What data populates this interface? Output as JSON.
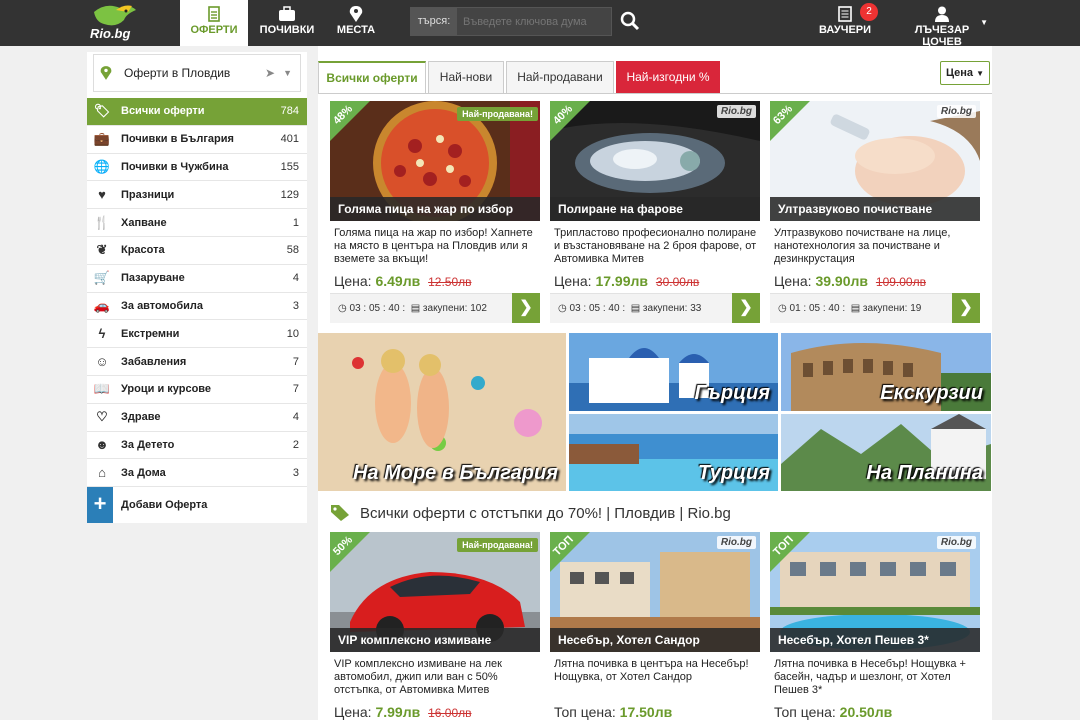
{
  "header": {
    "logo_text": "Rio.bg",
    "nav": [
      {
        "label": "ОФЕРТИ",
        "icon": "document-icon"
      },
      {
        "label": "ПОЧИВКИ",
        "icon": "suitcase-icon"
      },
      {
        "label": "МЕСТА",
        "icon": "map-marker-icon"
      }
    ],
    "search_label": "търся:",
    "search_placeholder": "Въведете ключова дума",
    "vouchers_label": "ВАУЧЕРИ",
    "vouchers_badge": "2",
    "user_name": "ЛЪЧЕЗАР ЦОЧЕВ"
  },
  "sidebar": {
    "city": "Оферти в Пловдив",
    "items": [
      {
        "label": "Всички оферти",
        "count": "784",
        "icon": "tag-icon"
      },
      {
        "label": "Почивки в България",
        "count": "401",
        "icon": "suitcase-icon"
      },
      {
        "label": "Почивки в Чужбина",
        "count": "155",
        "icon": "globe-icon"
      },
      {
        "label": "Празници",
        "count": "129",
        "icon": "heart-icon"
      },
      {
        "label": "Хапване",
        "count": "1",
        "icon": "cutlery-icon"
      },
      {
        "label": "Красота",
        "count": "58",
        "icon": "leaf-icon"
      },
      {
        "label": "Пазаруване",
        "count": "4",
        "icon": "cart-icon"
      },
      {
        "label": "За автомобила",
        "count": "3",
        "icon": "car-icon"
      },
      {
        "label": "Екстремни",
        "count": "10",
        "icon": "bolt-icon"
      },
      {
        "label": "Забавления",
        "count": "7",
        "icon": "smile-icon"
      },
      {
        "label": "Уроци и курсове",
        "count": "7",
        "icon": "book-icon"
      },
      {
        "label": "Здраве",
        "count": "4",
        "icon": "heartbeat-icon"
      },
      {
        "label": "За Детето",
        "count": "2",
        "icon": "child-icon"
      },
      {
        "label": "За Дома",
        "count": "3",
        "icon": "home-icon"
      }
    ],
    "add_label": "Добави Оферта"
  },
  "tabs": [
    {
      "label": "Всички оферти"
    },
    {
      "label": "Най-нови"
    },
    {
      "label": "Най-продавани"
    },
    {
      "label": "Най-изгодни %"
    }
  ],
  "sort_label": "Цена",
  "offers": [
    {
      "title": "Голяма пица на жар по избор",
      "desc": "Голяма пица на жар по избор! Хапнете на място в центъра на Пловдив или я вземете за вкъщи!",
      "price_label": "Цена:",
      "price": "6.49лв",
      "old_price": "12.50лв",
      "discount": "48%",
      "time": "03 : 05 : 40 :",
      "bought": "закупени: 102",
      "sold_badge": "Най-продавана!"
    },
    {
      "title": "Полиране на фарове",
      "desc": "Трипластово професионално полиране и възстановяване на 2 броя фарове, от Автомивка Митев",
      "price_label": "Цена:",
      "price": "17.99лв",
      "old_price": "30.00лв",
      "discount": "40%",
      "time": "03 : 05 : 40 :",
      "bought": "закупени: 33",
      "watermark": "Rio.bg"
    },
    {
      "title": "Ултразвуково почистване",
      "desc": "Ултразвуково почистване на лице, нанотехнология за почистване и дезинкрустация",
      "price_label": "Цена:",
      "price": "39.90лв",
      "old_price": "109.00лв",
      "discount": "63%",
      "time": "01 : 05 : 40 :",
      "bought": "закупени: 19",
      "watermark": "Rio.bg"
    }
  ],
  "promos": [
    {
      "label": "На Море в България"
    },
    {
      "label": "Гърция"
    },
    {
      "label": "Екскурзии"
    },
    {
      "label": "Турция"
    },
    {
      "label": "На Планина"
    }
  ],
  "section_title": "Всички оферти с отстъпки до 70%! | Пловдив | Rio.bg",
  "offers2": [
    {
      "title": "VIP комплексно измиване",
      "desc": "VIP комплексно измиване на лек автомобил, джип или ван с 50% отстъпка, от Автомивка Митев",
      "price_label": "Цена:",
      "price": "7.99лв",
      "old_price": "16.00лв",
      "discount": "50%",
      "sold_badge": "Най-продавана!"
    },
    {
      "title": "Несебър, Хотел Сандор",
      "desc": "Лятна почивка в центъра на Несебър! Нощувка, от Хотел Сандор",
      "price_label": "Топ цена:",
      "price": "17.50лв",
      "discount": "ТОП",
      "watermark": "Rio.bg"
    },
    {
      "title": "Несебър, Хотел Пешев 3*",
      "desc": "Лятна почивка в Несебър! Нощувка + басейн, чадър и шезлонг, от Хотел Пешев 3*",
      "price_label": "Топ цена:",
      "price": "20.50лв",
      "discount": "ТОП",
      "watermark": "Rio.bg"
    }
  ]
}
